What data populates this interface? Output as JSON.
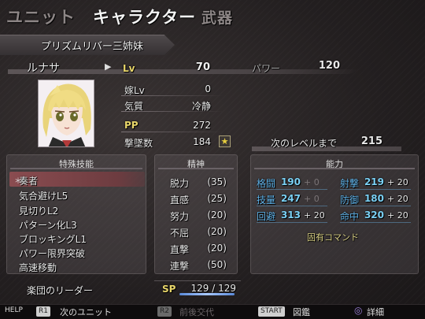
{
  "header": {
    "tabs": [
      {
        "label": "ユニット",
        "active": false
      },
      {
        "label": "キャラクター",
        "active": true
      },
      {
        "label": "武器",
        "active": false
      }
    ]
  },
  "unit": {
    "group": "プリズムリバー三姉妹",
    "name": "ルナサ"
  },
  "stats": {
    "lv_label": "Lv",
    "lv": "70",
    "yome_label": "嫁Lv",
    "yome": "0",
    "kishitsu_label": "気質",
    "kishitsu": "冷静",
    "pp_label": "PP",
    "pp": "272",
    "kills_label": "撃墜数",
    "kills": "184",
    "star": "★",
    "power_label": "パワー",
    "power": "120",
    "next_label": "次のレベルまで",
    "next": "215"
  },
  "skills": {
    "title": "特殊技能",
    "items": [
      "奏者",
      "気合避けL5",
      "見切りL2",
      "パターン化L3",
      "ブロッキングL1",
      "パワー限界突破",
      "高速移動"
    ],
    "selected_mark": "＊",
    "leader": "楽団のリーダー"
  },
  "spirit": {
    "title": "精神",
    "items": [
      {
        "name": "脱力",
        "cost": "(35)"
      },
      {
        "name": "直感",
        "cost": "(25)"
      },
      {
        "name": "努力",
        "cost": "(20)"
      },
      {
        "name": "不屈",
        "cost": "(20)"
      },
      {
        "name": "直撃",
        "cost": "(20)"
      },
      {
        "name": "連撃",
        "cost": "(50)"
      }
    ],
    "sp_label": "SP",
    "sp": "129 / 129"
  },
  "ability": {
    "title": "能力",
    "rows": [
      {
        "l1": "格闘",
        "v1": "190",
        "b1": "+ 0",
        "l2": "射撃",
        "v2": "219",
        "b2": "+ 20"
      },
      {
        "l1": "技量",
        "v1": "247",
        "b1": "+ 0",
        "l2": "防御",
        "v2": "180",
        "b2": "+ 20"
      },
      {
        "l1": "回避",
        "v1": "313",
        "b1": "+ 20",
        "l2": "命中",
        "v2": "320",
        "b2": "+ 20"
      }
    ],
    "unique_cmd": "固有コマンド"
  },
  "footer": {
    "help": "HELP",
    "r1": "R1",
    "r1_text": "次のユニット",
    "r2": "R2",
    "r2_text": "前後交代",
    "start": "START",
    "start_text": "図鑑",
    "circle": "◎",
    "circle_text": "詳細"
  },
  "colors": {
    "accent_yellow": "#e8d66a",
    "ability_blue": "#7ad0f4",
    "selection": "#8a4c50"
  }
}
